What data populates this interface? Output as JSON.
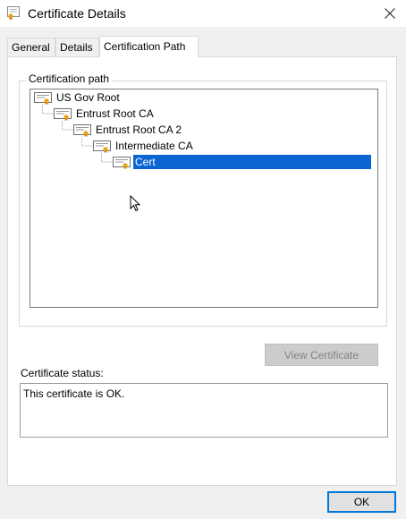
{
  "window": {
    "title": "Certificate Details",
    "icon": "certificate-icon",
    "close_icon": "close-icon"
  },
  "tabs": [
    {
      "label": "General",
      "active": false
    },
    {
      "label": "Details",
      "active": false
    },
    {
      "label": "Certification Path",
      "active": true
    }
  ],
  "certification_path": {
    "group_label": "Certification path",
    "items": [
      {
        "label": "US Gov Root",
        "level": 0,
        "selected": false
      },
      {
        "label": "Entrust Root CA",
        "level": 1,
        "selected": false
      },
      {
        "label": "Entrust Root CA 2",
        "level": 2,
        "selected": false
      },
      {
        "label": "Intermediate CA",
        "level": 3,
        "selected": false
      },
      {
        "label": "Cert",
        "level": 4,
        "selected": true
      }
    ],
    "view_certificate_label": "View Certificate"
  },
  "status": {
    "label": "Certificate status:",
    "text": "This certificate is OK."
  },
  "ok_label": "OK",
  "colors": {
    "selection": "#0a64d2",
    "accent": "#0078d7",
    "dialog_bg": "#f0f0f0"
  }
}
